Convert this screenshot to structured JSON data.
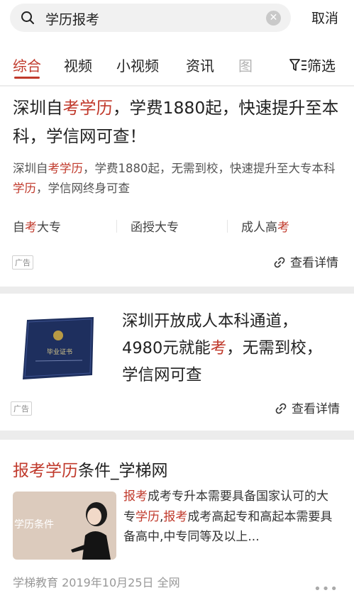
{
  "search": {
    "query": "学历报考",
    "cancel_label": "取消"
  },
  "tabs": [
    {
      "label": "综合"
    },
    {
      "label": "视频"
    },
    {
      "label": "小视频"
    },
    {
      "label": "资讯"
    },
    {
      "label": "图"
    }
  ],
  "filter_label": "筛选",
  "ad1": {
    "title_parts": [
      "深圳自",
      "考学历",
      "，学费1880起，快速提升至本科，学信网可查！"
    ],
    "desc_parts": [
      "深圳自",
      "考学历",
      "，学费1880起，无需到校，快速提升至大专本科",
      "学历",
      "，学信网终身可查"
    ],
    "sublinks": [
      {
        "before": "自",
        "hl": "考",
        "after": "大专"
      },
      {
        "before": "函授大专",
        "hl": "",
        "after": ""
      },
      {
        "before": "成人高",
        "hl": "考",
        "after": ""
      }
    ],
    "ad_badge": "广告",
    "detail_label": "查看详情"
  },
  "ad2": {
    "title_parts": [
      "深圳开放成人本科通道，4980元就能",
      "考",
      "，无需到校，学信网可查"
    ],
    "cert_text": "毕业证书",
    "ad_badge": "广告",
    "detail_label": "查看详情"
  },
  "result": {
    "title_parts": [
      "报考学历",
      "条件_学梯网"
    ],
    "thumb_text": "学历条件",
    "desc_parts": [
      "报考",
      "成考专升本需要具备国家认可的大专",
      "学历",
      ",",
      "报考",
      "成考高起专和高起本需要具备高中,中专同等及以上..."
    ],
    "meta": "学梯教育  2019年10月25日  全网"
  },
  "colors": {
    "accent": "#c0392b"
  }
}
